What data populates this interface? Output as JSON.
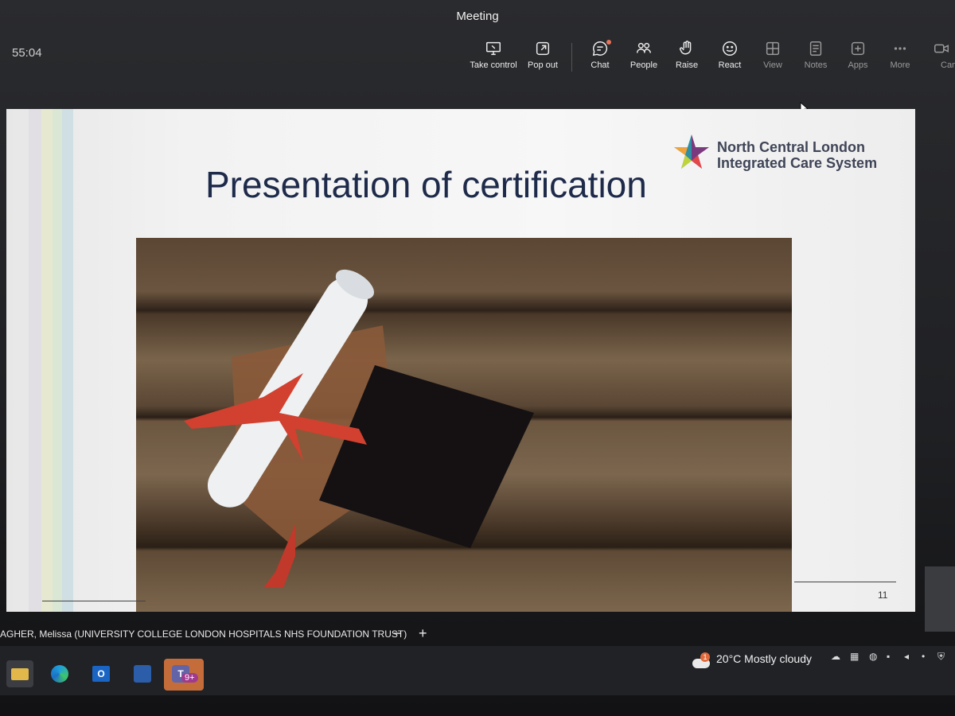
{
  "window": {
    "title": "Meeting",
    "timer": "55:04"
  },
  "toolbar": [
    {
      "name": "take-control-button",
      "label": "Take control",
      "icon": "screen-share-icon"
    },
    {
      "name": "pop-out-button",
      "label": "Pop out",
      "icon": "pop-out-icon"
    },
    {
      "name": "chat-button",
      "label": "Chat",
      "icon": "chat-icon"
    },
    {
      "name": "people-button",
      "label": "People",
      "icon": "people-icon"
    },
    {
      "name": "raise-button",
      "label": "Raise",
      "icon": "hand-icon"
    },
    {
      "name": "react-button",
      "label": "React",
      "icon": "smile-icon"
    },
    {
      "name": "view-button",
      "label": "View",
      "icon": "grid-icon"
    },
    {
      "name": "notes-button",
      "label": "Notes",
      "icon": "notes-icon"
    },
    {
      "name": "apps-button",
      "label": "Apps",
      "icon": "plus-box-icon"
    },
    {
      "name": "more-button",
      "label": "More",
      "icon": "more-icon"
    },
    {
      "name": "camera-button",
      "label": "Cam",
      "icon": "camera-icon"
    }
  ],
  "slide": {
    "title": "Presentation of certification",
    "logo_line1": "North Central London",
    "logo_line2": "Integrated Care System",
    "number": "11"
  },
  "presenter": {
    "name": "AGHER, Melissa (UNIVERSITY COLLEGE LONDON HOSPITALS NHS FOUNDATION TRUST)",
    "zoom_out": "−",
    "zoom_in": "+"
  },
  "taskbar": {
    "teams_badge": "9+",
    "weather_alert": "1",
    "weather_text": "20°C  Mostly cloudy"
  },
  "colors": {
    "accent_red": "#e8735a",
    "slide_title": "#1e2a4a",
    "teams_purple": "#6264a7"
  }
}
